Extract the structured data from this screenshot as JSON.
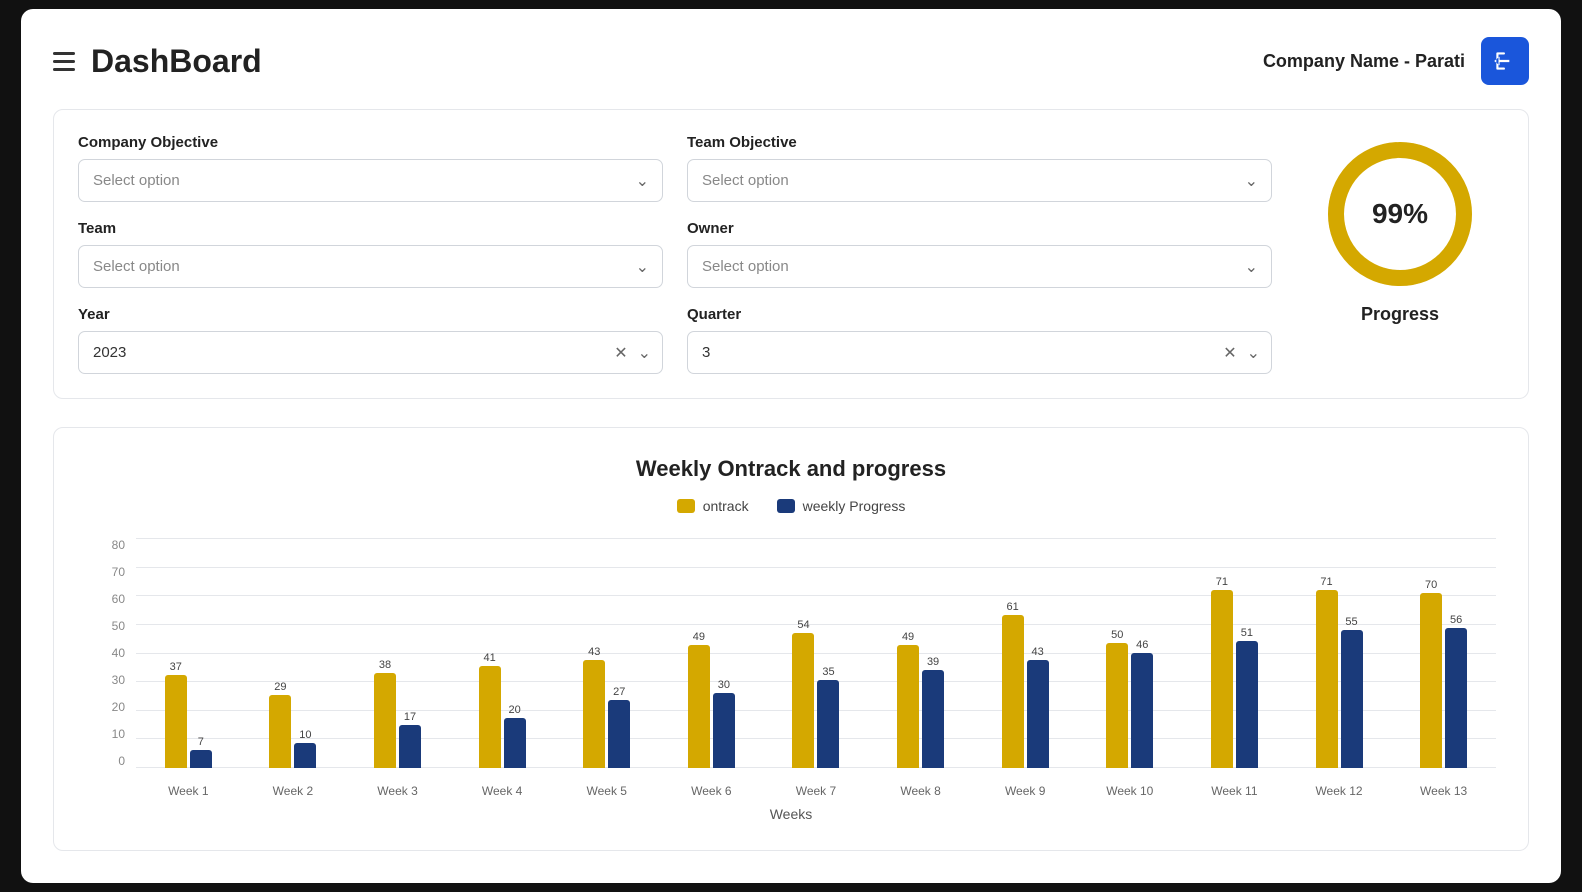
{
  "header": {
    "title": "DashBoard",
    "company": "Company Name - Parati",
    "logout_label": "logout"
  },
  "filters": {
    "company_objective_label": "Company Objective",
    "company_objective_placeholder": "Select option",
    "team_objective_label": "Team Objective",
    "team_objective_placeholder": "Select option",
    "team_label": "Team",
    "team_placeholder": "Select option",
    "owner_label": "Owner",
    "owner_placeholder": "Select option",
    "year_label": "Year",
    "year_value": "2023",
    "quarter_label": "Quarter",
    "quarter_value": "3"
  },
  "progress": {
    "value": 99,
    "label": "Progress",
    "display": "99%"
  },
  "chart": {
    "title": "Weekly Ontrack and progress",
    "legend": {
      "ontrack": "ontrack",
      "weekly": "weekly Progress"
    },
    "x_axis_title": "Weeks",
    "y_labels": [
      "0",
      "10",
      "20",
      "30",
      "40",
      "50",
      "60",
      "70",
      "80"
    ],
    "weeks": [
      {
        "label": "Week 1",
        "ontrack": 37,
        "weekly": 7
      },
      {
        "label": "Week 2",
        "ontrack": 29,
        "weekly": 10
      },
      {
        "label": "Week 3",
        "ontrack": 38,
        "weekly": 17
      },
      {
        "label": "Week 4",
        "ontrack": 41,
        "weekly": 20
      },
      {
        "label": "Week 5",
        "ontrack": 43,
        "weekly": 27
      },
      {
        "label": "Week 6",
        "ontrack": 49,
        "weekly": 30
      },
      {
        "label": "Week 7",
        "ontrack": 54,
        "weekly": 35
      },
      {
        "label": "Week 8",
        "ontrack": 49,
        "weekly": 39
      },
      {
        "label": "Week 9",
        "ontrack": 61,
        "weekly": 43
      },
      {
        "label": "Week 10",
        "ontrack": 50,
        "weekly": 46
      },
      {
        "label": "Week 11",
        "ontrack": 71,
        "weekly": 51
      },
      {
        "label": "Week 12",
        "ontrack": 71,
        "weekly": 55
      },
      {
        "label": "Week 13",
        "ontrack": 70,
        "weekly": 56
      }
    ]
  }
}
